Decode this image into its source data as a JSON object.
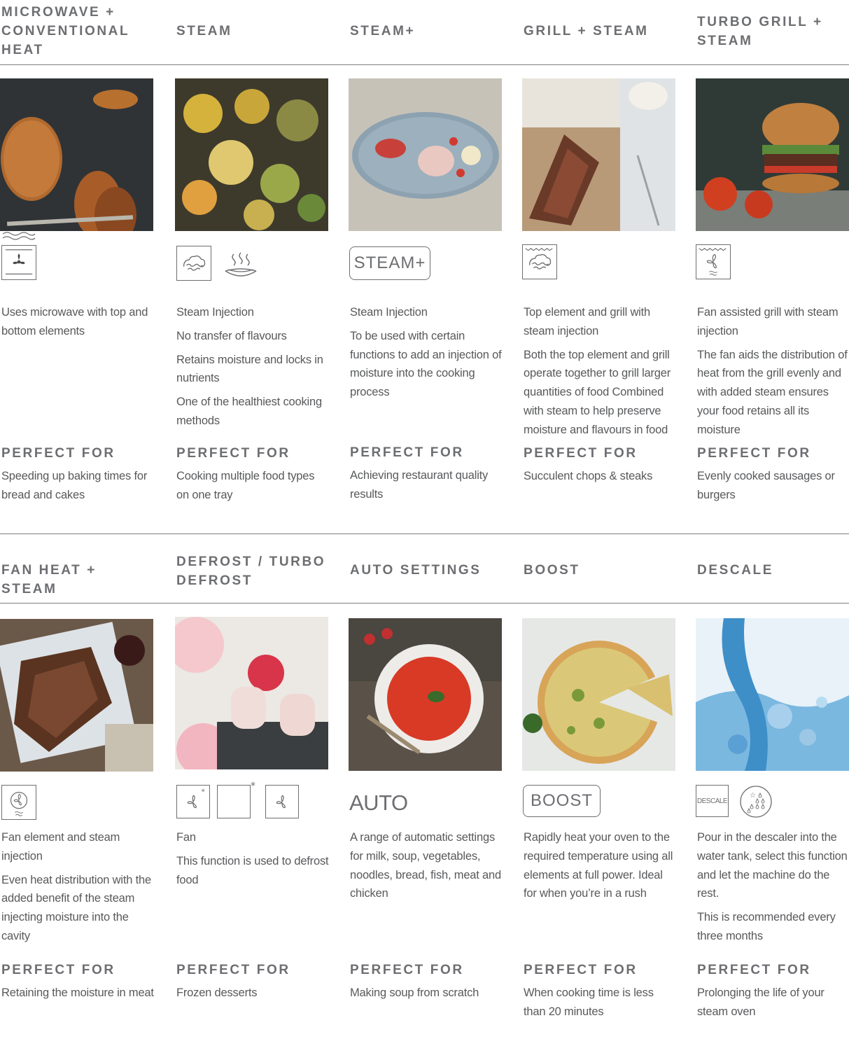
{
  "row1": [
    {
      "title": "MICROWAVE + CONVENTIONAL HEAT",
      "description": [
        "Uses microwave with top and bottom elements"
      ],
      "perfect_for_label": "PERFECT FOR",
      "perfect_for": "Speeding up baking times for bread and cakes",
      "icons": [
        "microwave-waves-icon",
        "fan-oven-icon"
      ],
      "photo": "bread-photo"
    },
    {
      "title": "STEAM",
      "description": [
        "Steam Injection",
        "No transfer of flavours",
        "Retains moisture and locks in nutrients",
        "One of the healthiest cooking methods"
      ],
      "perfect_for_label": "PERFECT FOR",
      "perfect_for": "Cooking multiple food types on one tray",
      "icons": [
        "steam-box-icon",
        "steam-dish-icon"
      ],
      "photo": "vegetables-photo"
    },
    {
      "title": "STEAM+",
      "description": [
        "Steam Injection",
        "To be used with certain functions to add an injection of moisture into the cooking process"
      ],
      "perfect_for_label": "PERFECT FOR",
      "perfect_for": "Achieving restaurant quality results",
      "badge": "STEAM+",
      "photo": "plated-dish-photo"
    },
    {
      "title": "GRILL + STEAM",
      "description": [
        "Top element and grill with steam injection",
        "Both the top element and grill operate together to grill larger quantities of food Combined with steam to help preserve moisture and flavours in food"
      ],
      "perfect_for_label": "PERFECT FOR",
      "perfect_for": "Succulent chops & steaks",
      "icons": [
        "grill-steam-icon"
      ],
      "photo": "steak-photo"
    },
    {
      "title": "TURBO GRILL + STEAM",
      "description": [
        "Fan assisted grill with steam injection",
        "The fan aids the distribution of heat from the grill evenly and with added steam ensures your food retains all its moisture"
      ],
      "perfect_for_label": "PERFECT FOR",
      "perfect_for": "Evenly cooked sausages or burgers",
      "icons": [
        "turbo-grill-steam-icon"
      ],
      "photo": "burger-photo"
    }
  ],
  "row2": [
    {
      "title": "FAN HEAT + STEAM",
      "description": [
        "Fan element and steam injection",
        "Even heat distribution with the added benefit of the steam injecting moisture into the cavity"
      ],
      "perfect_for_label": "PERFECT FOR",
      "perfect_for": "Retaining the moisture in meat",
      "icons": [
        "fan-element-steam-icon"
      ],
      "photo": "roast-meat-photo"
    },
    {
      "title": "DEFROST / TURBO DEFROST",
      "description": [
        "Fan",
        "This function is used to defrost food"
      ],
      "perfect_for_label": "PERFECT FOR",
      "perfect_for": "Frozen desserts",
      "icons": [
        "fan-defrost-icon",
        "defrost-icon",
        "fan-icon"
      ],
      "photo": "desserts-photo"
    },
    {
      "title": "AUTO SETTINGS",
      "description": [
        "A range of automatic settings for milk, soup, vegetables, noodles, bread, fish, meat and chicken"
      ],
      "perfect_for_label": "PERFECT FOR",
      "perfect_for": "Making soup from scratch",
      "auto_label": "AUTO",
      "photo": "soup-photo"
    },
    {
      "title": "BOOST",
      "description": [
        "Rapidly heat your oven to the required temperature using all elements at full power. Ideal for when you’re in a rush"
      ],
      "perfect_for_label": "PERFECT FOR",
      "perfect_for": "When cooking time is less than 20 minutes",
      "badge": "BOOST",
      "photo": "quiche-photo"
    },
    {
      "title": "DESCALE",
      "description": [
        "Pour in the descaler into the water tank, select this function and let the machine do the rest.",
        "This is recommended every three months"
      ],
      "perfect_for_label": "PERFECT FOR",
      "perfect_for": "Prolonging the life of your steam oven",
      "icon_label": "DESCALE",
      "icons": [
        "descale-icon",
        "water-drops-icon"
      ],
      "photo": "water-photo"
    }
  ],
  "colors": {
    "heading": "#6d6e71",
    "body": "#58595b",
    "rule": "#7d7e80"
  }
}
